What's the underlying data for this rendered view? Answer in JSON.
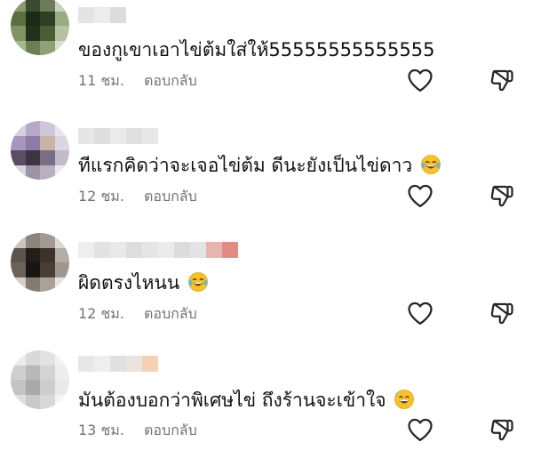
{
  "comments": [
    {
      "text": "ของกูเขาเอาไข่ต้มใส่ให้55555555555555",
      "time": "11 ชม.",
      "reply_label": "ตอบกลับ",
      "emoji": ""
    },
    {
      "text": "ทีแรกคิดว่าจะเจอไข่ต้ม ดีนะยังเป็นไข่ดาว",
      "time": "12 ชม.",
      "reply_label": "ตอบกลับ",
      "emoji": "tears-of-joy"
    },
    {
      "text": "ผิดตรงไหนน",
      "time": "12 ชม.",
      "reply_label": "ตอบกลับ",
      "emoji": "tears-of-joy"
    },
    {
      "text": "มันต้องบอกว่าพิเศษไข่ ถึงร้านจะเข้าใจ",
      "time": "13 ชม.",
      "reply_label": "ตอบกลับ",
      "emoji": "grinning-sweat"
    }
  ],
  "colors": {
    "text": "#121212",
    "meta": "#737373",
    "icon_stroke": "#262626"
  }
}
